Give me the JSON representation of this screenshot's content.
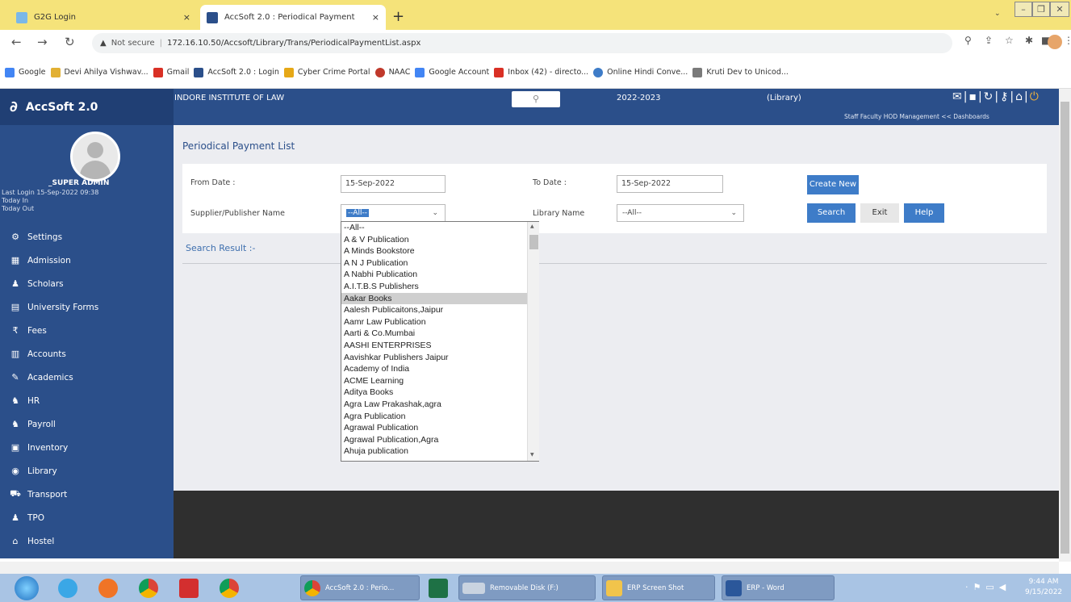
{
  "browser": {
    "tabs": [
      {
        "title": "G2G Login",
        "close": "×"
      },
      {
        "title": "AccSoft 2.0 : Periodical Payment",
        "close": "×"
      }
    ],
    "new_tab": "+",
    "url_prefix": "Not secure",
    "url": "172.16.10.50/Accsoft/Library/Trans/PeriodicalPaymentList.aspx",
    "bookmarks": [
      {
        "label": "Google",
        "color": "#4285f4"
      },
      {
        "label": "Devi Ahilya Vishwav...",
        "color": "#e2b033"
      },
      {
        "label": "Gmail",
        "color": "#d93025"
      },
      {
        "label": "AccSoft 2.0 : Login",
        "color": "#2b4f8a"
      },
      {
        "label": "Cyber Crime Portal",
        "color": "#e6a817"
      },
      {
        "label": "NAAC",
        "color": "#c0392b"
      },
      {
        "label": "Google Account",
        "color": "#4285f4"
      },
      {
        "label": "Inbox (42) - directo...",
        "color": "#d93025"
      },
      {
        "label": "Online Hindi Conve...",
        "color": "#3e7cc8"
      },
      {
        "label": "Kruti Dev to Unicod...",
        "color": "#7a7a7a"
      }
    ]
  },
  "header": {
    "brand": "AccSoft 2.0",
    "institute": "INDORE INSTITUTE OF LAW",
    "session": "2022-2023",
    "module": "(Library)",
    "links": "Staff   Faculty   HOD   Management << Dashboards"
  },
  "user": {
    "name": "_SUPER ADMIN",
    "last_login": "Last Login     15-Sep-2022 09:38",
    "today_in": "Today In",
    "today_out": "Today Out"
  },
  "sidebar": {
    "items": [
      {
        "label": "Settings",
        "icon": "⚙"
      },
      {
        "label": "Admission",
        "icon": "▦"
      },
      {
        "label": "Scholars",
        "icon": "♟"
      },
      {
        "label": "University Forms",
        "icon": "▤"
      },
      {
        "label": "Fees",
        "icon": "₹"
      },
      {
        "label": "Accounts",
        "icon": "▥"
      },
      {
        "label": "Academics",
        "icon": "✎"
      },
      {
        "label": "HR",
        "icon": "♞"
      },
      {
        "label": "Payroll",
        "icon": "♞"
      },
      {
        "label": "Inventory",
        "icon": "▣"
      },
      {
        "label": "Library",
        "icon": "◉"
      },
      {
        "label": "Transport",
        "icon": "⛟"
      },
      {
        "label": "TPO",
        "icon": "♟"
      },
      {
        "label": "Hostel",
        "icon": "⌂"
      }
    ]
  },
  "page": {
    "title": "Periodical Payment List",
    "from_date_label": "From Date :",
    "from_date_value": "15-Sep-2022",
    "to_date_label": "To Date :",
    "to_date_value": "15-Sep-2022",
    "supplier_label": "Supplier/Publisher Name",
    "supplier_value": "--All--",
    "library_label": "Library Name",
    "library_value": "--All--",
    "create_new": "Create New",
    "search": "Search",
    "exit": "Exit",
    "help": "Help",
    "search_result": "Search Result :-"
  },
  "dropdown": {
    "highlighted_index": 6,
    "options": [
      "--All--",
      "A & V Publication",
      "A Minds Bookstore",
      "A N J Publication",
      "A Nabhi Publication",
      "A.I.T.B.S Publishers",
      "Aakar Books",
      "Aalesh Publicaitons,Jaipur",
      "Aamr Law Publication",
      "Aarti & Co.Mumbai",
      "AASHI ENTERPRISES",
      "Aavishkar Publishers  Jaipur",
      "Academy of India",
      "ACME Learning",
      "Aditya Books",
      "Agra Law Prakashak,agra",
      "Agra Publication",
      "Agrawal Publication",
      "Agrawal Publication,Agra",
      "Ahuja publication"
    ]
  },
  "taskbar": {
    "apps": [
      {
        "label": "AccSoft 2.0 : Perio..."
      },
      {
        "label": "Removable Disk (F:)"
      },
      {
        "label": "ERP Screen Shot"
      },
      {
        "label": "ERP - Word"
      }
    ],
    "time": "9:44 AM",
    "date": "9/15/2022"
  }
}
